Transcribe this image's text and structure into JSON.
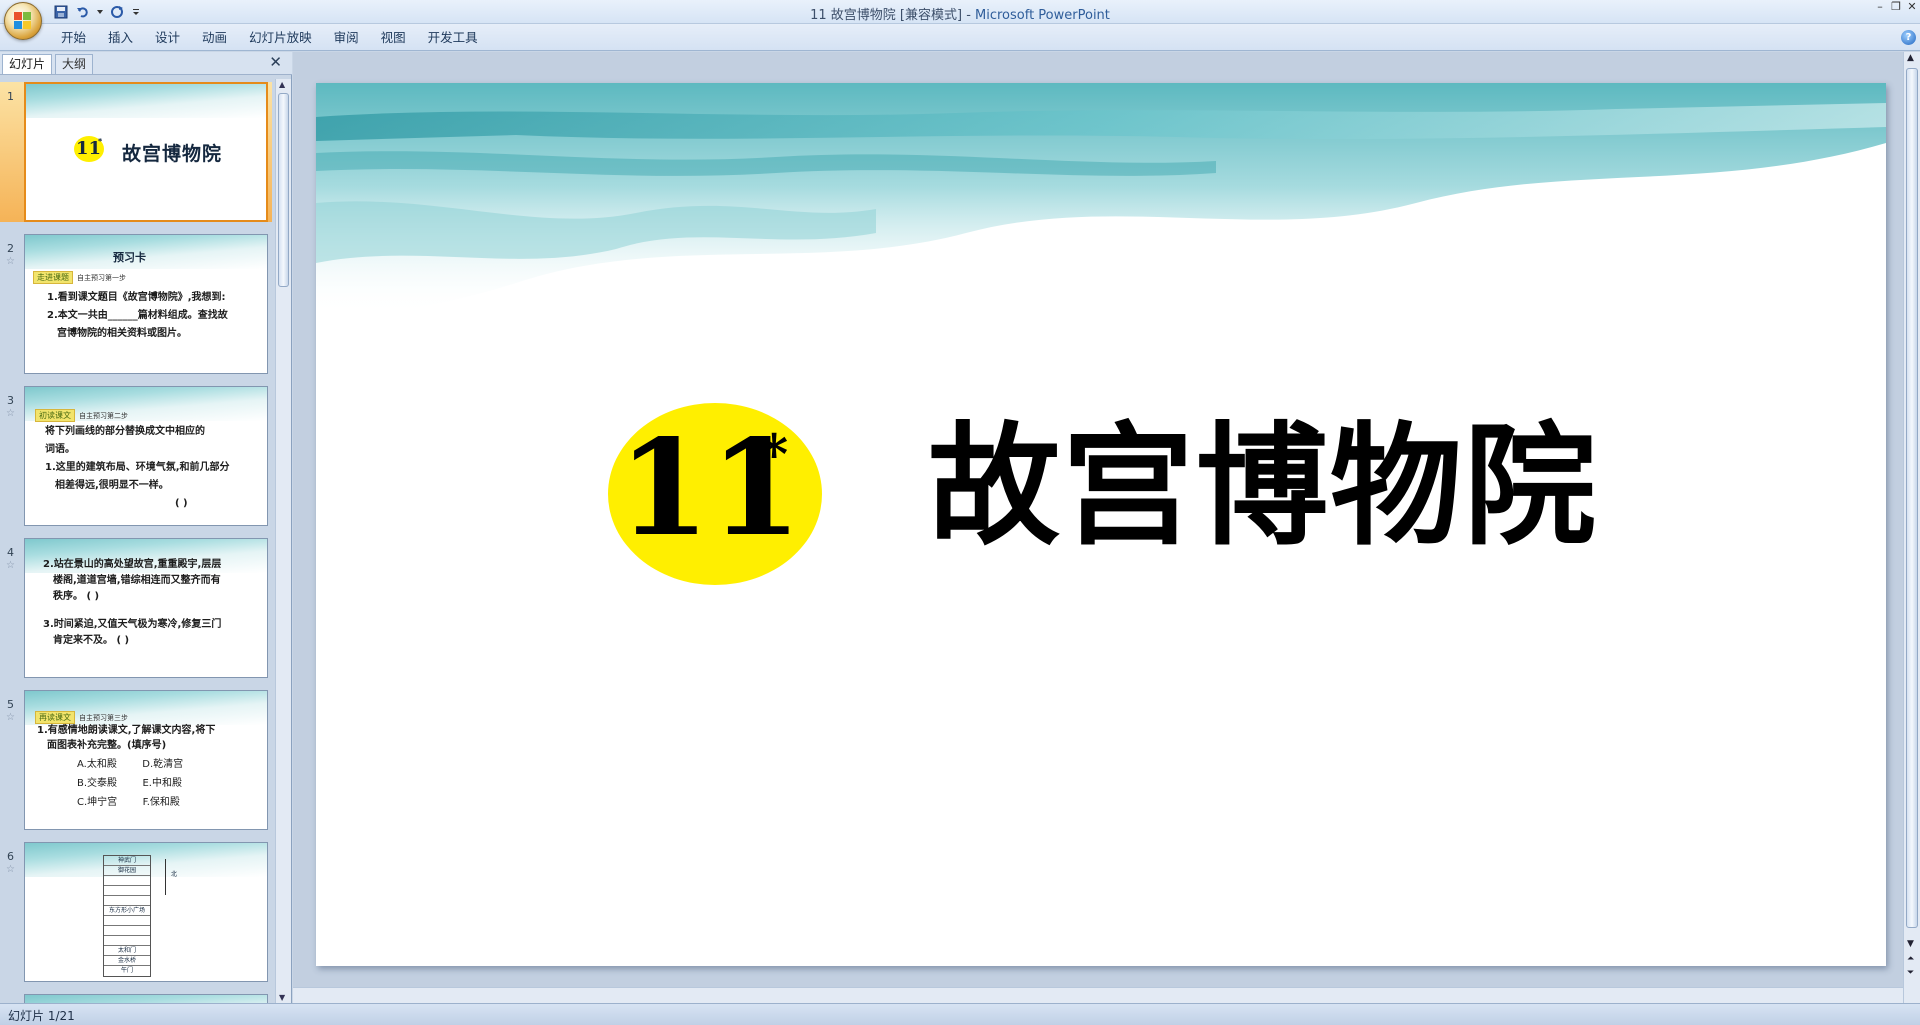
{
  "window": {
    "title_doc": "11 故宫博物院 [兼容模式] - ",
    "title_app": "Microsoft PowerPoint"
  },
  "ribbon": {
    "tabs": [
      "开始",
      "插入",
      "设计",
      "动画",
      "幻灯片放映",
      "审阅",
      "视图",
      "开发工具"
    ]
  },
  "pane": {
    "tab_slides": "幻灯片",
    "tab_outline": "大纲"
  },
  "thumbnails": [
    {
      "num": "1",
      "title_num": "11",
      "title": "故宫博物院"
    },
    {
      "num": "2",
      "header": "预习卡",
      "tag": "走进课题",
      "tag_sub": "自主预习第一步",
      "lines": [
        "1.看到课文题目《故宫博物院》,我想到:",
        "2.本文一共由______篇材料组成。查找故",
        "宫博物院的相关资料或图片。"
      ]
    },
    {
      "num": "3",
      "tag": "初读课文",
      "tag_sub": "自主预习第二步",
      "lines": [
        "将下列画线的部分替换成文中相应的",
        "词语。",
        "1.这里的建筑布局、环境气氛,和前几部分",
        "相差得远,很明显不一样。",
        "(              )"
      ]
    },
    {
      "num": "4",
      "lines": [
        "2.站在景山的高处望故宫,重重殿宇,层层",
        "楼阁,道道宫墙,错综相连而又整齐而有",
        "秩序。                    (          )",
        "",
        "3.时间紧迫,又值天气极为寒冷,修复三门",
        "肯定来不及。              (          )"
      ]
    },
    {
      "num": "5",
      "tag": "再读课文",
      "tag_sub": "自主预习第三步",
      "lines": [
        "1.有感情地朗读课文,了解课文内容,将下",
        "面图表补充完整。(填序号)",
        "A.太和殿        D.乾清宫",
        "B.交泰殿        E.中和殿",
        "C.坤宁宫        F.保和殿"
      ]
    },
    {
      "num": "6",
      "cells": [
        "神武门",
        "御花园",
        "",
        "",
        "",
        "东方形小广场",
        "",
        "",
        "",
        "太和门",
        "金水桥",
        "午门"
      ],
      "side": "北"
    }
  ],
  "main_slide": {
    "number": "11",
    "asterisk": "*",
    "title": "故宫博物院"
  },
  "status": {
    "slide_info": "幻灯片 1/21"
  },
  "colors": {
    "accent_yellow": "#ffef00",
    "selection_orange": "#e58b1a",
    "teal_header": "#7fc8cd"
  }
}
